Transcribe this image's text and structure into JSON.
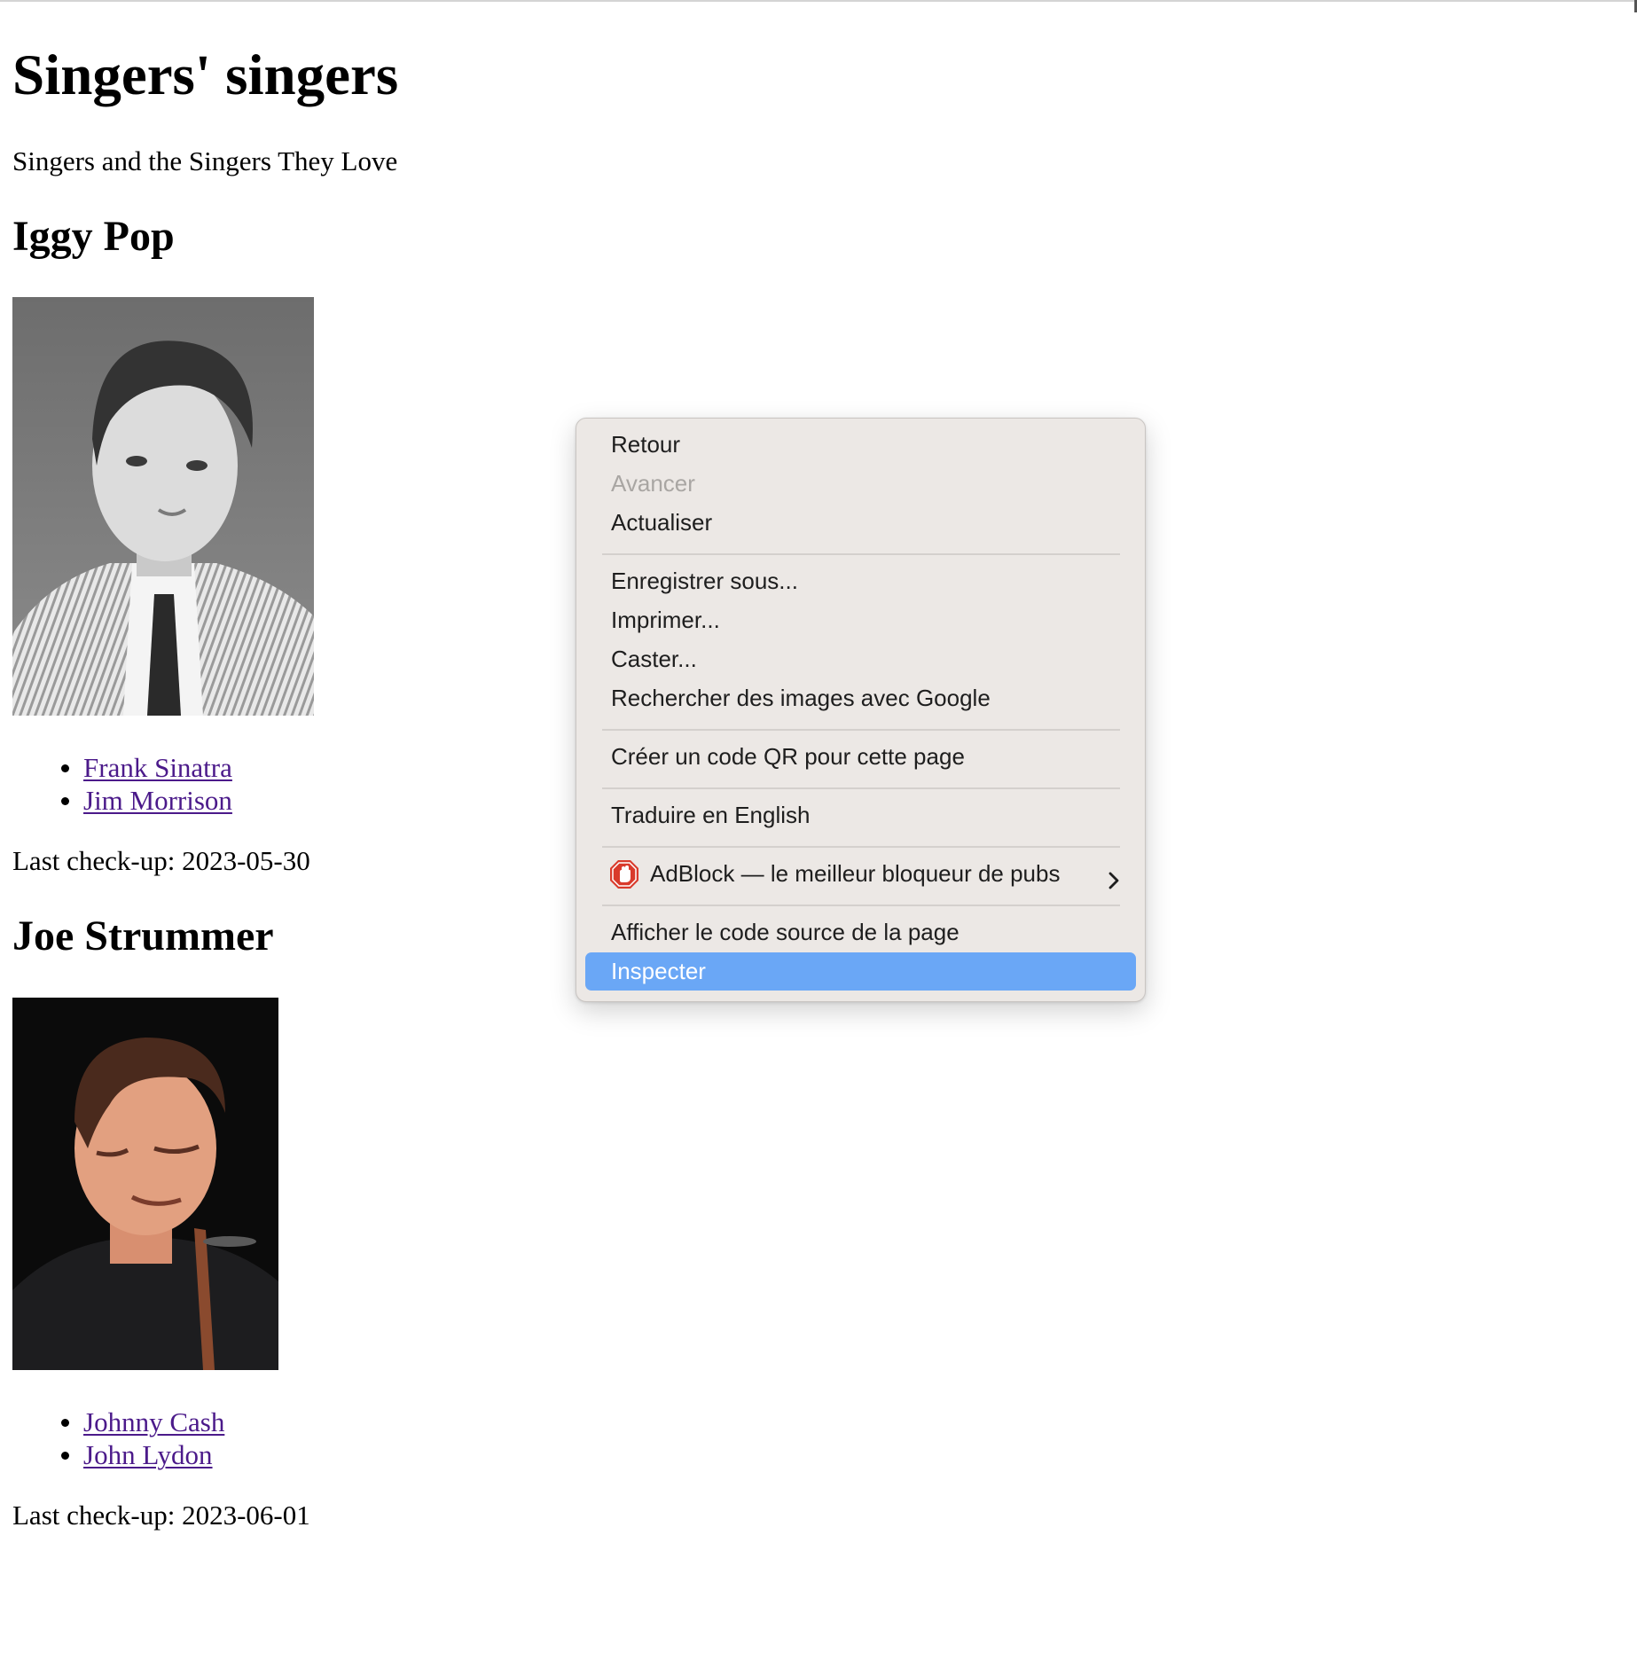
{
  "site": {
    "title": "Singers' singers",
    "tagline": "Singers and the Singers They Love"
  },
  "singers": [
    {
      "name": "Iggy Pop",
      "photo": "iggy-pop-photo",
      "influences": [
        "Frank Sinatra",
        "Jim Morrison"
      ],
      "checkup_label": "Last check-up: 2023-05-30"
    },
    {
      "name": "Joe Strummer",
      "photo": "joe-strummer-photo",
      "influences": [
        "Johnny Cash",
        "John Lydon"
      ],
      "checkup_label": "Last check-up: 2023-06-01"
    }
  ],
  "context_menu": {
    "items": [
      {
        "label": "Retour",
        "enabled": true
      },
      {
        "label": "Avancer",
        "enabled": false
      },
      {
        "label": "Actualiser",
        "enabled": true
      },
      {
        "label": "Enregistrer sous...",
        "enabled": true
      },
      {
        "label": "Imprimer...",
        "enabled": true
      },
      {
        "label": "Caster...",
        "enabled": true
      },
      {
        "label": "Rechercher des images avec Google",
        "enabled": true
      },
      {
        "label": "Créer un code QR pour cette page",
        "enabled": true
      },
      {
        "label": "Traduire en English",
        "enabled": true
      },
      {
        "label": "AdBlock — le meilleur bloqueur de pubs",
        "enabled": true,
        "icon": "adblock-hand-icon",
        "submenu": true
      },
      {
        "label": "Afficher le code source de la page",
        "enabled": true
      },
      {
        "label": "Inspecter",
        "enabled": true,
        "highlighted": true
      }
    ],
    "highlight_color": "#6aa7f6",
    "background_color": "#ece8e5"
  },
  "colors": {
    "link": "#4b1a8a",
    "adblock_red": "#d93a2b"
  }
}
